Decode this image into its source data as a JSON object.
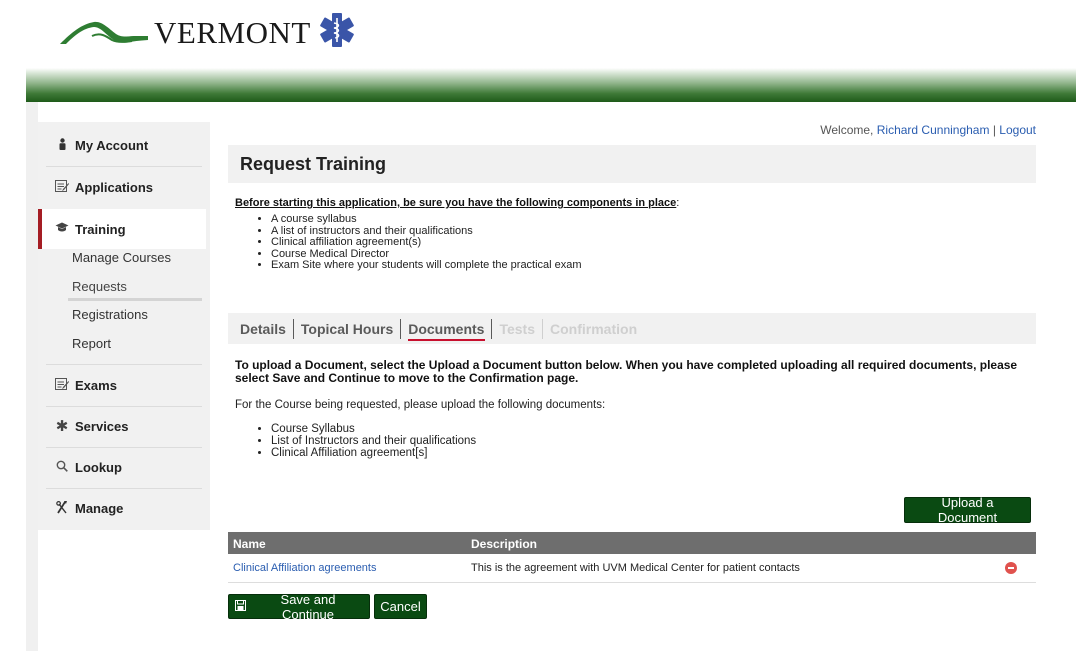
{
  "header": {
    "logo_text": "VERMONT",
    "logo_icon": "vermont-mountains-icon",
    "emblem_icon": "star-of-life-icon"
  },
  "user": {
    "welcome_prefix": "Welcome,",
    "name": "Richard Cunningham",
    "separator": "|",
    "logout": "Logout"
  },
  "sidebar": {
    "items": [
      {
        "label": "My Account",
        "icon": "person-icon"
      },
      {
        "label": "Applications",
        "icon": "form-icon"
      },
      {
        "label": "Training",
        "icon": "graduation-cap-icon"
      },
      {
        "label": "Exams",
        "icon": "form-icon"
      },
      {
        "label": "Services",
        "icon": "asterisk-icon"
      },
      {
        "label": "Lookup",
        "icon": "search-icon"
      },
      {
        "label": "Manage",
        "icon": "tools-icon"
      }
    ],
    "training_sub": [
      "Manage Courses",
      "Requests",
      "Registrations",
      "Report"
    ],
    "active": "Training",
    "active_sub": "Requests"
  },
  "page": {
    "title": "Request Training",
    "intro_underlined": "Before starting this application, be sure you have the following components in place",
    "intro_suffix": ":",
    "components": [
      "A course syllabus",
      "A list of instructors and their qualifications",
      "Clinical affiliation agreement(s)",
      "Course Medical Director",
      "Exam Site where your students will complete the practical exam"
    ]
  },
  "tabs": [
    {
      "label": "Details",
      "state": "enabled"
    },
    {
      "label": "Topical Hours",
      "state": "enabled"
    },
    {
      "label": "Documents",
      "state": "current"
    },
    {
      "label": "Tests",
      "state": "disabled"
    },
    {
      "label": "Confirmation",
      "state": "disabled"
    }
  ],
  "documents": {
    "instructions": "To upload a Document, select the Upload a Document button below. When you have completed uploading all required documents, please select Save and Continue to move to the Confirmation page.",
    "note": "For the Course being requested, please upload the following documents:",
    "required": [
      "Course Syllabus",
      "List of Instructors and their qualifications",
      "Clinical Affiliation agreement[s]"
    ],
    "upload_label": "Upload a Document",
    "table": {
      "headers": [
        "Name",
        "Description"
      ],
      "rows": [
        {
          "name": "Clinical Affiliation agreements",
          "description": "This is the agreement with UVM Medical Center for patient contacts"
        }
      ]
    }
  },
  "actions": {
    "save_label": "Save and Continue",
    "cancel_label": "Cancel"
  },
  "colors": {
    "brand_green": "#0a4a12",
    "active_red": "#a51d24",
    "table_header": "#6e6e6e",
    "link_blue": "#2a5db0"
  }
}
